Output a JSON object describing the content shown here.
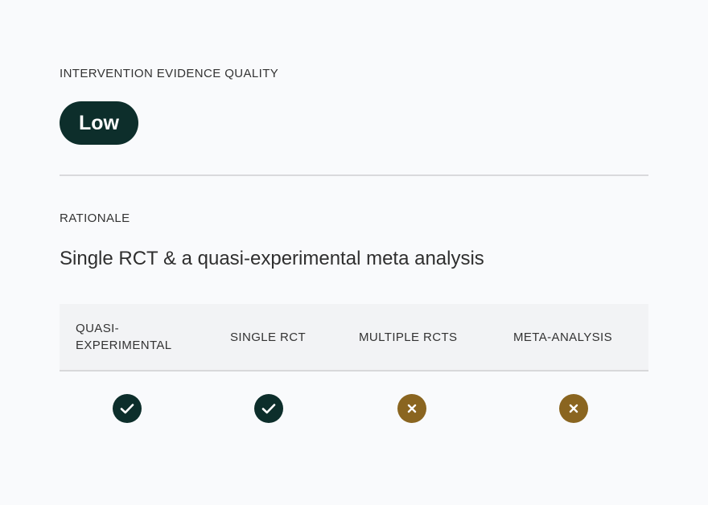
{
  "quality": {
    "label": "INTERVENTION EVIDENCE QUALITY",
    "value": "Low"
  },
  "rationale": {
    "label": "RATIONALE",
    "text": "Single RCT & a quasi-experimental meta analysis"
  },
  "evidence_table": {
    "columns": [
      {
        "label": "QUASI-EXPERIMENTAL",
        "status": "check-icon",
        "met": true
      },
      {
        "label": "SINGLE RCT",
        "status": "check-icon",
        "met": true
      },
      {
        "label": "MULTIPLE RCTS",
        "status": "x-icon",
        "met": false
      },
      {
        "label": "META-ANALYSIS",
        "status": "x-icon",
        "met": false
      }
    ]
  },
  "colors": {
    "primary": "#0d2e2b",
    "negative": "#8a6520",
    "background": "#f9fafc",
    "header_bg": "#f2f3f5"
  }
}
